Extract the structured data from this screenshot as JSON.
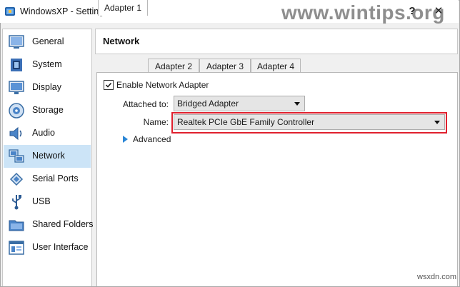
{
  "window": {
    "title": "WindowsXP - Settings",
    "help_glyph": "?",
    "close_glyph": "✕",
    "watermark": "www.wintips.org",
    "credit": "wsxdn.com"
  },
  "sidebar": {
    "items": [
      {
        "label": "General",
        "icon": "general-icon"
      },
      {
        "label": "System",
        "icon": "system-chip-icon"
      },
      {
        "label": "Display",
        "icon": "display-monitor-icon"
      },
      {
        "label": "Storage",
        "icon": "storage-disk-icon"
      },
      {
        "label": "Audio",
        "icon": "audio-speaker-icon"
      },
      {
        "label": "Network",
        "icon": "network-icon",
        "selected": true
      },
      {
        "label": "Serial Ports",
        "icon": "serial-port-icon"
      },
      {
        "label": "USB",
        "icon": "usb-icon"
      },
      {
        "label": "Shared Folders",
        "icon": "shared-folder-icon"
      },
      {
        "label": "User Interface",
        "icon": "user-interface-icon"
      }
    ]
  },
  "header": {
    "title": "Network"
  },
  "tabs": [
    {
      "label": "Adapter 1",
      "active": true
    },
    {
      "label": "Adapter 2"
    },
    {
      "label": "Adapter 3"
    },
    {
      "label": "Adapter 4"
    }
  ],
  "adapter": {
    "enable_label": "Enable Network Adapter",
    "enabled": true,
    "attached_label": "Attached to:",
    "attached_value": "Bridged Adapter",
    "name_label": "Name:",
    "name_value": "Realtek PCIe GbE Family Controller",
    "advanced_label": "Advanced"
  },
  "colors": {
    "selection": "#cce4f7",
    "highlight_border": "#e0202e",
    "accent_blue": "#2a86d6"
  }
}
